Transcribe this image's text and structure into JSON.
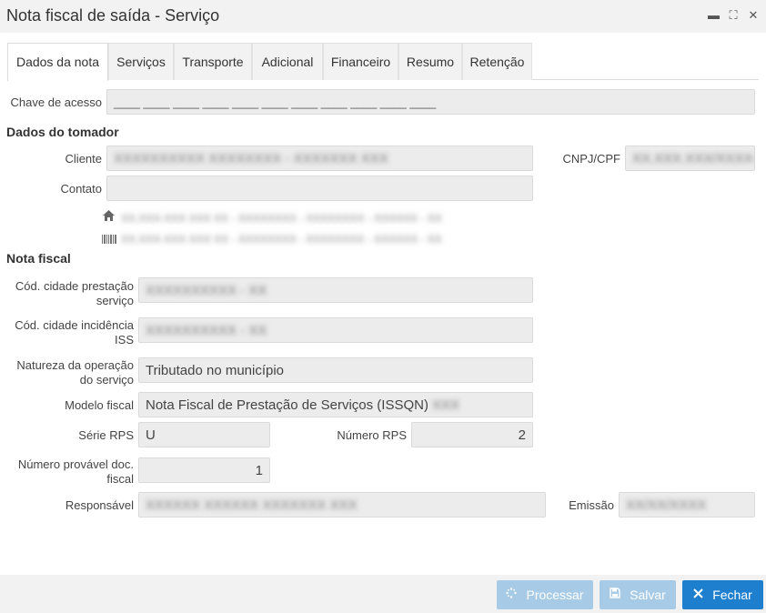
{
  "window": {
    "title": "Nota fiscal de saída - Serviço",
    "minimize_glyph": "▬",
    "maximize_glyph": "⛶",
    "close_glyph": "✕"
  },
  "tabs": [
    {
      "label": "Dados da nota"
    },
    {
      "label": "Serviços"
    },
    {
      "label": "Transporte"
    },
    {
      "label": "Adicional"
    },
    {
      "label": "Financeiro"
    },
    {
      "label": "Resumo"
    },
    {
      "label": "Retenção"
    }
  ],
  "access_key": {
    "label": "Chave de acesso",
    "value": "____ ____ ____ ____ ____ ____ ____ ____ ____ ____ ____"
  },
  "customer_section": {
    "title": "Dados do tomador",
    "client_label": "Cliente",
    "client_value": "XXXXXXXXXX XXXXXXXX - XXXXXXX XXX",
    "cnpj_label": "CNPJ/CPF",
    "cnpj_value": "XX.XXX.XXX/XXXX-X",
    "contact_label": "Contato",
    "contact_value": "",
    "address_home": "XX.XXX-XXX XXX XX - XXXXXXXX - XXXXXXXX - XXXXXX - XX",
    "address_billing": "XX.XXX-XXX XXX XX - XXXXXXXX - XXXXXXXX - XXXXXX - XX"
  },
  "invoice_section": {
    "title": "Nota fiscal",
    "city_service_label": "Cód. cidade prestação serviço",
    "city_service_value": "XXXXXXXXXX - XX",
    "city_iss_label": "Cód. cidade incidência ISS",
    "city_iss_value": "XXXXXXXXXX - XX",
    "nature_label": "Natureza da operação do serviço",
    "nature_value": "Tributado no município",
    "model_label": "Modelo fiscal",
    "model_value": "Nota Fiscal de Prestação de Serviços (ISSQN)",
    "model_suffix": "XXX",
    "rps_series_label": "Série RPS",
    "rps_series_value": "U",
    "rps_number_label": "Número RPS",
    "rps_number_value": "2",
    "probable_number_label": "Número provável doc. fiscal",
    "probable_number_value": "1",
    "responsible_label": "Responsável",
    "responsible_value": "XXXXXX XXXXXX XXXXXXX XXX",
    "emission_label": "Emissão",
    "emission_value": "XX/XX/XXXX"
  },
  "buttons": {
    "process": "Processar",
    "save": "Salvar",
    "close": "Fechar"
  },
  "icons": {
    "home": "home-icon",
    "barcode": "barcode-icon",
    "process": "spinner-icon",
    "save": "floppy-disk-icon",
    "close": "close-icon"
  },
  "colors": {
    "primary": "#1f7fcf",
    "disabled_button": "#a7cbe7",
    "field_bg": "#ececec",
    "titlebar_bg": "#f2f2f2"
  }
}
